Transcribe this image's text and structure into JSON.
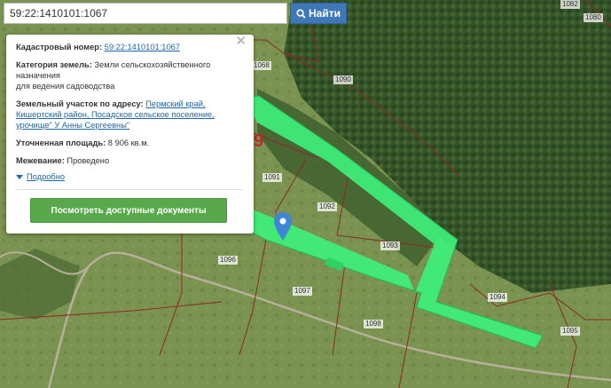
{
  "search": {
    "value": "59:22:1410101:1067",
    "button_label": "Найти"
  },
  "popup": {
    "cadastral_label": "Кадастровый номер:",
    "cadastral_value": "59:22:1410101:1067",
    "category_label": "Категория земель:",
    "category_value": "Земли сельскохозяйственного назначения",
    "category_use": "для ведения садоводства",
    "address_label": "Земельный участок по адресу:",
    "address_value": "Пермский край, Кишертский район, Посадское сельское поселение, урочище\" У Анны Сергеевны\"",
    "area_label": "Уточненная площадь:",
    "area_value": "8 906 кв.м.",
    "survey_label": "Межевание:",
    "survey_value": "Проведено",
    "more_label": "Подробно",
    "documents_button": "Посмотреть доступные документы"
  },
  "parcels": [
    {
      "id": "1068",
      "label": "1068"
    },
    {
      "id": "1090",
      "label": "1090"
    },
    {
      "id": "1091",
      "label": "1091"
    },
    {
      "id": "1092",
      "label": "1092"
    },
    {
      "id": "1093",
      "label": "1093"
    },
    {
      "id": "1094",
      "label": "1094"
    },
    {
      "id": "1095",
      "label": "1095"
    },
    {
      "id": "1096",
      "label": "1096"
    },
    {
      "id": "1097",
      "label": "1097"
    },
    {
      "id": "1098",
      "label": "1098"
    },
    {
      "id": "1080",
      "label": "1080"
    },
    {
      "id": "1082",
      "label": "1082"
    }
  ],
  "colors": {
    "accent": "#3f78b8",
    "highlight": "#3ef07a",
    "boundary": "#8a2a2a",
    "button_green": "#5aa84c"
  }
}
